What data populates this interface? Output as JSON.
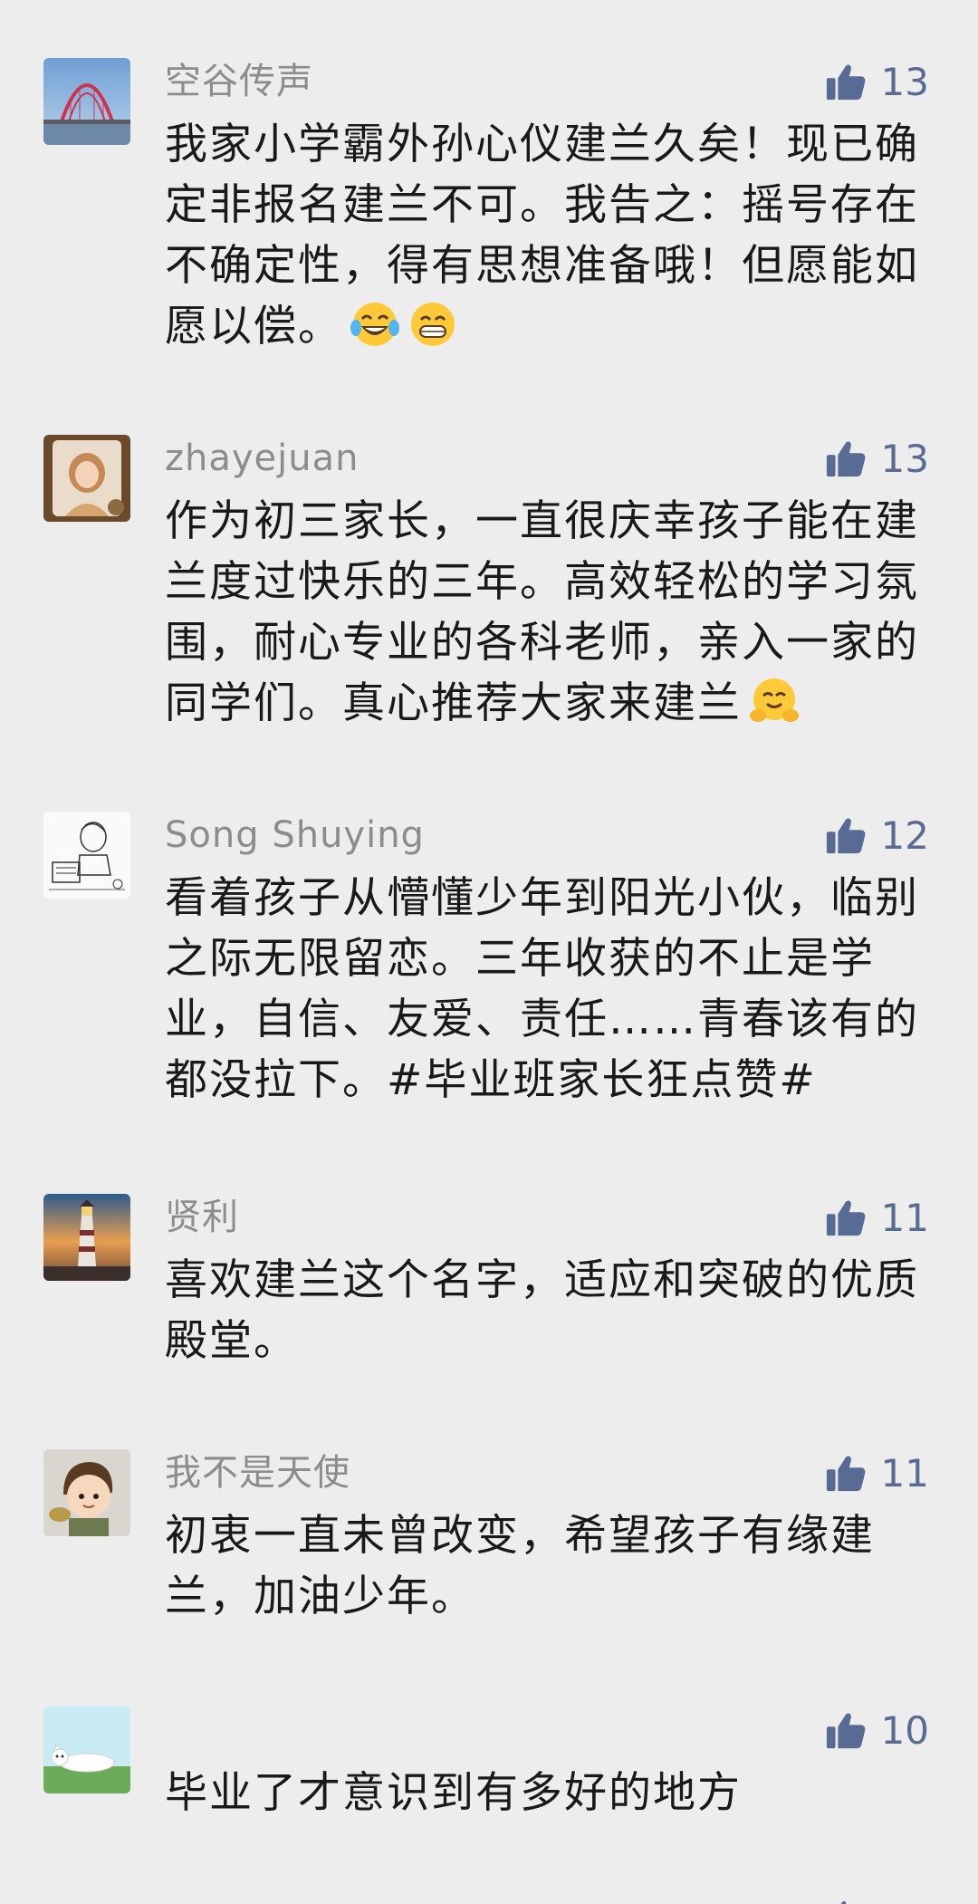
{
  "comments": [
    {
      "author": "空谷传声",
      "likes": "13",
      "text": "我家小学霸外孙心仪建兰久矣！现已确定非报名建兰不可。我告之：摇号存在不确定性，得有思想准备哦！但愿能如愿以偿。",
      "emojis": [
        "laughing-tears-emoji",
        "grinning-emoji"
      ],
      "avatar": "bridge-avatar"
    },
    {
      "author": "zhayejuan",
      "likes": "13",
      "text": "作为初三家长，一直很庆幸孩子能在建兰度过快乐的三年。高效轻松的学习氛围，耐心专业的各科老师，亲入一家的同学们。真心推荐大家来建兰",
      "emojis": [
        "hugging-emoji"
      ],
      "avatar": "woman-portrait-avatar"
    },
    {
      "author": "Song Shuying",
      "likes": "12",
      "text": "看着孩子从懵懂少年到阳光小伙，临别之际无限留恋。三年收获的不止是学业，自信、友爱、责任……青春该有的都没拉下。#毕业班家长狂点赞#",
      "emojis": [],
      "avatar": "sketch-avatar"
    },
    {
      "author": "贤利",
      "likes": "11",
      "text": "喜欢建兰这个名字，适应和突破的优质殿堂。",
      "emojis": [],
      "avatar": "lighthouse-avatar"
    },
    {
      "author": "我不是天使",
      "likes": "11",
      "text": "初衷一直未曾改变，希望孩子有缘建兰，加油少年。",
      "emojis": [],
      "avatar": "cartoon-kid-avatar"
    },
    {
      "author": "",
      "likes": "10",
      "text": "毕业了才意识到有多好的地方",
      "emojis": [],
      "avatar": "lying-cat-avatar"
    }
  ],
  "colors": {
    "background": "#ededed",
    "author": "#8c8c8c",
    "text": "#191919",
    "like": "#576b95"
  }
}
